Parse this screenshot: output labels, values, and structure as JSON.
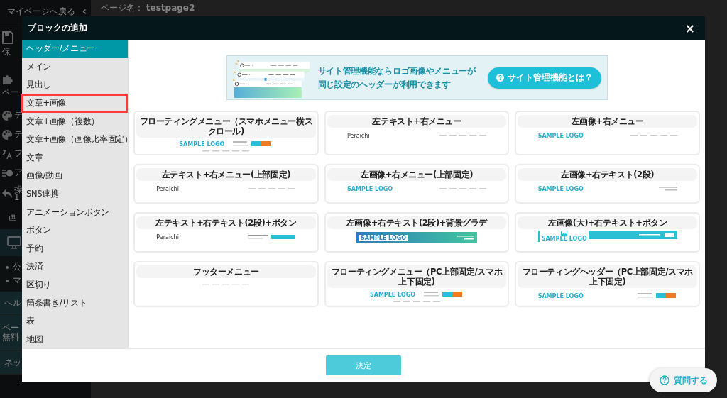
{
  "page": {
    "back_link": "マイページへ戻る",
    "collapse_icon": "‹",
    "page_name": "ページ名： **testpage2**"
  },
  "app_sidebar": [
    {
      "kind": "icon-label",
      "label": "保"
    },
    {
      "kind": "icon-label",
      "label": "ペー"
    },
    {
      "kind": "icon-inline",
      "label": "テ"
    },
    {
      "kind": "icon-inline",
      "label": "テ"
    },
    {
      "kind": "icon-inline",
      "label": "フ"
    },
    {
      "kind": "icon-inline",
      "label": "ア"
    },
    {
      "kind": "icon-two",
      "label": "操",
      "sub": "1"
    },
    {
      "kind": "plain",
      "label": "画"
    },
    {
      "kind": "band"
    },
    {
      "kind": "bullets",
      "lines": [
        "公",
        "マ"
      ]
    },
    {
      "kind": "section",
      "label": "ヘル"
    },
    {
      "kind": "two",
      "label": "ペー",
      "sub": "無料"
    },
    {
      "kind": "section",
      "label": "ネッ"
    }
  ],
  "dialog": {
    "title": "ブロックの追加",
    "close": "×",
    "categories": [
      {
        "label": "ヘッダー/メニュー",
        "selected": true,
        "highlighted": false
      },
      {
        "label": "メイン",
        "selected": false,
        "highlighted": false
      },
      {
        "label": "見出し",
        "selected": false,
        "highlighted": false
      },
      {
        "label": "文章+画像",
        "selected": false,
        "highlighted": true
      },
      {
        "label": "文章+画像（複数）",
        "selected": false,
        "highlighted": false
      },
      {
        "label": "文章+画像（画像比率固定）",
        "selected": false,
        "highlighted": false
      },
      {
        "label": "文章",
        "selected": false,
        "highlighted": false
      },
      {
        "label": "画像/動画",
        "selected": false,
        "highlighted": false
      },
      {
        "label": "SNS連携",
        "selected": false,
        "highlighted": false
      },
      {
        "label": "アニメーションボタン",
        "selected": false,
        "highlighted": false
      },
      {
        "label": "ボタン",
        "selected": false,
        "highlighted": false
      },
      {
        "label": "予約",
        "selected": false,
        "highlighted": false
      },
      {
        "label": "決済",
        "selected": false,
        "highlighted": false
      },
      {
        "label": "区切り",
        "selected": false,
        "highlighted": false
      },
      {
        "label": "箇条書き/リスト",
        "selected": false,
        "highlighted": false
      },
      {
        "label": "表",
        "selected": false,
        "highlighted": false
      },
      {
        "label": "地図",
        "selected": false,
        "highlighted": false
      }
    ],
    "banner": {
      "message_lines": [
        "サイト管理機能ならロゴ画像やメニューが",
        "同じ設定のヘッダーが利用できます"
      ],
      "button": "サイト管理機能とは？"
    },
    "blocks": [
      {
        "title": "フローティングメニュー（スマホメニュー横スクロール)",
        "preview": {
          "kind": "float",
          "logo": "SAMPLE LOGO"
        }
      },
      {
        "title": "左テキスト+右メニュー",
        "preview": {
          "kind": "text-menu",
          "logo": "Peraichi"
        }
      },
      {
        "title": "左画像+右メニュー",
        "preview": {
          "kind": "logo-menu",
          "logo": "SAMPLE LOGO"
        }
      },
      {
        "title": "左テキスト+右メニュー(上部固定)",
        "preview": {
          "kind": "text-menu",
          "logo": "Peraichi"
        }
      },
      {
        "title": "左画像+右メニュー(上部固定)",
        "preview": {
          "kind": "logo-menu",
          "logo": "SAMPLE LOGO"
        }
      },
      {
        "title": "左画像+右テキスト(2段)",
        "preview": {
          "kind": "logo-text",
          "logo": "SAMPLE LOGO"
        }
      },
      {
        "title": "左テキスト+右テキスト(2段)+ボタン",
        "preview": {
          "kind": "text-button",
          "logo": "Peraichi"
        }
      },
      {
        "title": "左画像+右テキスト(2段)+背景グラデ",
        "preview": {
          "kind": "gradient",
          "logo": "SAMPLE LOGO"
        }
      },
      {
        "title": "左画像(大)+右テキスト+ボタン",
        "preview": {
          "kind": "big-image",
          "logo": "SAMPLE LOGO"
        }
      },
      {
        "title": "フッターメニュー",
        "preview": {
          "kind": "footer"
        }
      },
      {
        "title": "フローティングメニュー（PC上部固定/スマホ上下固定)",
        "preview": {
          "kind": "float",
          "logo": "SAMPLE LOGO"
        }
      },
      {
        "title": "フローティングヘッダー（PC上部固定/スマホ上下固定)",
        "preview": {
          "kind": "float-header",
          "logo": "SAMPLE LOGO"
        }
      }
    ],
    "confirm_button": {
      "label": "決定",
      "disabled": true
    }
  },
  "help_button": {
    "label": "質問する"
  }
}
